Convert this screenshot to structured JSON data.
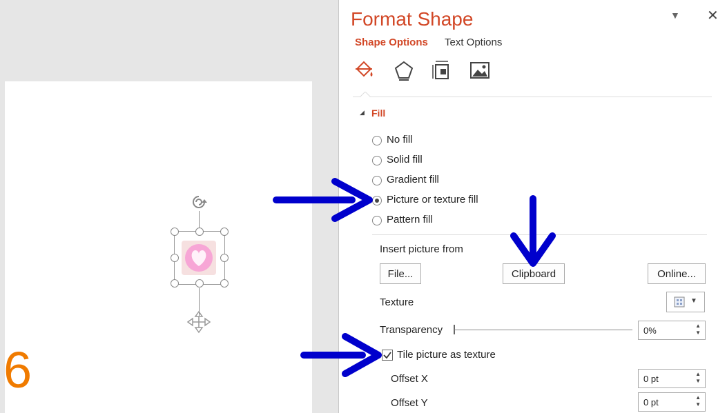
{
  "step_number": "6",
  "panel": {
    "title": "Format Shape",
    "tabs": [
      "Shape Options",
      "Text Options"
    ],
    "icons": [
      "fill-line-icon",
      "effects-icon",
      "size-properties-icon",
      "picture-icon"
    ],
    "section": "Fill",
    "options": [
      {
        "label": "No fill",
        "checked": false
      },
      {
        "label": "Solid fill",
        "checked": false
      },
      {
        "label": "Gradient fill",
        "checked": false
      },
      {
        "label": "Picture or texture fill",
        "checked": true
      },
      {
        "label": "Pattern fill",
        "checked": false
      }
    ],
    "insert_label": "Insert picture from",
    "buttons": {
      "file": "File...",
      "clipboard": "Clipboard",
      "online": "Online..."
    },
    "texture_label": "Texture",
    "transparency_label": "Transparency",
    "transparency_value": "0%",
    "tile_label": "Tile picture as texture",
    "tile_checked": true,
    "offset_x_label": "Offset X",
    "offset_x_value": "0 pt",
    "offset_y_label": "Offset Y",
    "offset_y_value": "0 pt"
  },
  "colors": {
    "accent": "#d24726",
    "arrow": "#0000cc",
    "step": "#f07b00",
    "heart": "#ee82c8"
  }
}
